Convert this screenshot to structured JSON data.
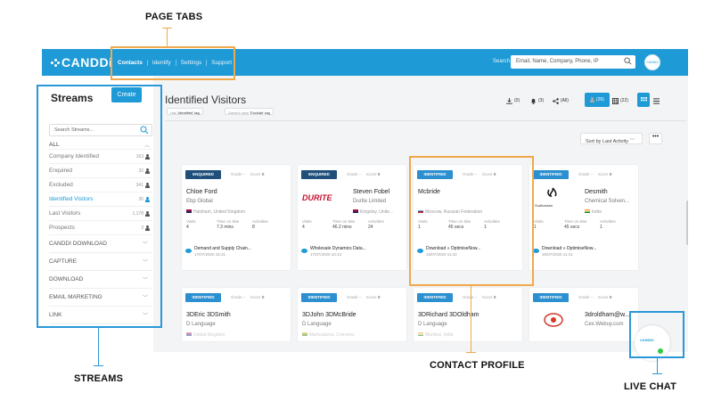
{
  "annotations": {
    "page_tabs": "PAGE TABS",
    "streams": "STREAMS",
    "contact_profile": "CONTACT PROFILE",
    "live_chat": "LIVE CHAT"
  },
  "app": {
    "logo": "CANDDi",
    "nav": [
      "Contacts",
      "Identify",
      "Settings",
      "Support"
    ],
    "search_label": "Search",
    "search_placeholder": "Email, Name, Company, Phone, IP",
    "avatar": "CANDDi"
  },
  "sidebar": {
    "title": "Streams",
    "create": "Create",
    "search_placeholder": "Search Streams...",
    "all": "ALL",
    "items": [
      {
        "label": "Company Identified",
        "count": "163"
      },
      {
        "label": "Enquired",
        "count": "32"
      },
      {
        "label": "Excluded",
        "count": "341"
      },
      {
        "label": "Identified Visitors",
        "count": "26"
      },
      {
        "label": "Last Visitors",
        "count": "1,178"
      },
      {
        "label": "Prospects",
        "count": "3"
      }
    ],
    "sections": [
      "CANDDI DOWNLOAD",
      "CAPTURE",
      "DOWNLOAD",
      "EMAIL MARKETING",
      "LINK"
    ]
  },
  "main": {
    "title": "Identified Visitors",
    "chip1_pre": "Has",
    "chip1_val": "'Identified' tag",
    "chip2_pre": "Doesn't have",
    "chip2_val": "'Exclude' tag",
    "toolbar": {
      "t1": "(0)",
      "t2": "(3)",
      "t3": "(All)",
      "people": "(26)",
      "grid": "(22)"
    },
    "sort": "Sort by Last Activity",
    "more": "•••"
  },
  "cards": [
    {
      "badge": "ENQUIRED",
      "grade": "Grade",
      "grade_val": "--",
      "score": "Score",
      "score_val": "0",
      "name": "Chloe Ford",
      "company": "Ebp Global",
      "location": "Halsham, United Kingdom",
      "visits": "4",
      "time": "7.3 mins",
      "activities": "8",
      "act": "Demand and Supply Chain...",
      "date": "17/07/2020 15:31"
    },
    {
      "badge": "ENQUIRED",
      "grade": "Grade",
      "grade_val": "--",
      "score": "Score",
      "score_val": "0",
      "name": "Steven Fobel",
      "company": "Durite Limited",
      "location": "Kingsley, Unite...",
      "logo": "DURITE",
      "visits": "4",
      "time": "46.2 mins",
      "activities": "24",
      "act": "Wholesale Dynamics Data...",
      "date": "17/07/2020 10:13"
    },
    {
      "badge": "IDENTIFIED",
      "grade": "Grade",
      "grade_val": "--",
      "score": "Score",
      "score_val": "0",
      "name": "Mcbride",
      "company": "",
      "location": "Moscow, Russian Federation",
      "visits": "1",
      "time": "45 secs",
      "activities": "1",
      "act": "Download » OptimiseNow...",
      "date": "16/07/2020 11:42"
    },
    {
      "badge": "IDENTIFIED",
      "grade": "Grade",
      "grade_val": "--",
      "score": "Score",
      "score_val": "0",
      "name": "Desmith",
      "company": "Chemical Solven...",
      "location": "India",
      "visits": "1",
      "time": "45 secs",
      "activities": "1",
      "act": "Download » OptimiseNow...",
      "date": "16/07/2020 11:41",
      "logo": "Sudhanshu"
    }
  ],
  "cards2": [
    {
      "badge": "IDENTIFIED",
      "grade": "Grade",
      "grade_val": "--",
      "score": "Score",
      "score_val": "0",
      "name": "3DEric 3DSmith",
      "company": "D Language",
      "location": "United Kingdom"
    },
    {
      "badge": "IDENTIFIED",
      "grade": "Grade",
      "grade_val": "--",
      "score": "Score",
      "score_val": "0",
      "name": "3DJohn 3DMcBride",
      "company": "D Language",
      "location": "Mamoudzou, Comoros"
    },
    {
      "badge": "IDENTIFIED",
      "grade": "Grade",
      "grade_val": "--",
      "score": "Score",
      "score_val": "0",
      "name": "3DRichard 3DOldham",
      "company": "D Language",
      "location": "Mumbai, India"
    },
    {
      "badge": "IDENTIFIED",
      "grade": "Grade",
      "grade_val": "--",
      "score": "Score",
      "score_val": "0",
      "name": "3droldham@w...",
      "company": "Cex.Webuy.com",
      "location": ""
    }
  ],
  "stat_labels": {
    "visits": "Visits",
    "time": "Time on Site",
    "activities": "Activities"
  },
  "livechat": {
    "logo": "CANDDi"
  },
  "colors": {
    "accent": "#1e9ad6",
    "annotation_orange": "#f0a84a",
    "annotation_blue": "#2a98d8",
    "status_green": "#2ecc40"
  }
}
